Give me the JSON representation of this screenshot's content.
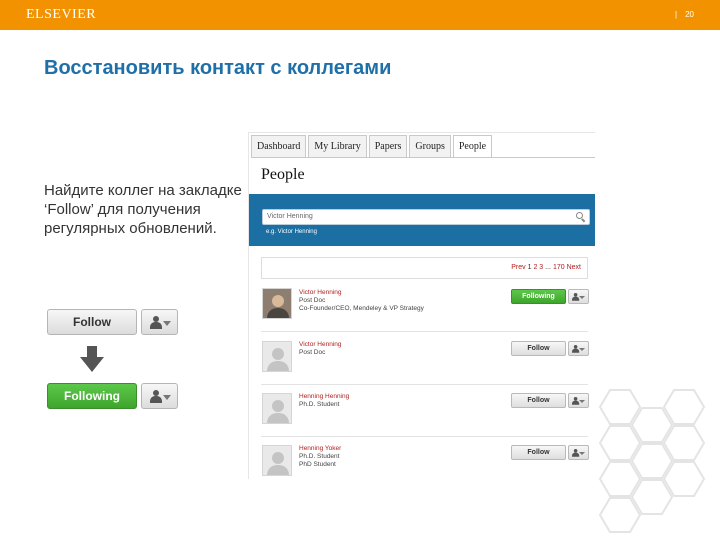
{
  "header": {
    "logo": "ELSEVIER",
    "page_separator": "|",
    "page_number": "20"
  },
  "slide": {
    "title": "Восстановить контакт с коллегами",
    "body": "Найдите коллег на закладке ‘Follow’ для получения регулярных обновлений."
  },
  "demo": {
    "follow_label": "Follow",
    "following_label": "Following"
  },
  "screenshot": {
    "tabs": [
      "Dashboard",
      "My Library",
      "Papers",
      "Groups",
      "People"
    ],
    "active_tab": "People",
    "title": "People",
    "search": {
      "value": "Victor Henning",
      "hint": "e.g. Victor Henning"
    },
    "pager": {
      "prev": "Prev",
      "p1": "1",
      "p2": "2",
      "p3": "3",
      "ellipsis": "...",
      "last": "170",
      "next": "Next"
    },
    "people": [
      {
        "name": "Victor Henning",
        "line1": "Post Doc",
        "line2": "Co-Founder/CEO, Mendeley & VP Strategy",
        "button": "Following",
        "state": "following",
        "photo": true
      },
      {
        "name": "Victor Henning",
        "line1": "Post Doc",
        "line2": "",
        "button": "Follow",
        "state": "follow",
        "photo": false
      },
      {
        "name": "Henning Henning",
        "line1": "Ph.D. Student",
        "line2": "",
        "button": "Follow",
        "state": "follow",
        "photo": false
      },
      {
        "name": "Henning Yoker",
        "line1": "Ph.D. Student",
        "line2": "PhD Student",
        "button": "Follow",
        "state": "follow",
        "photo": false
      }
    ]
  },
  "colors": {
    "header": "#f39200",
    "title": "#1f6fa8",
    "band": "#1b6fa3",
    "following": "#4cb63a",
    "name_link": "#b02020"
  }
}
